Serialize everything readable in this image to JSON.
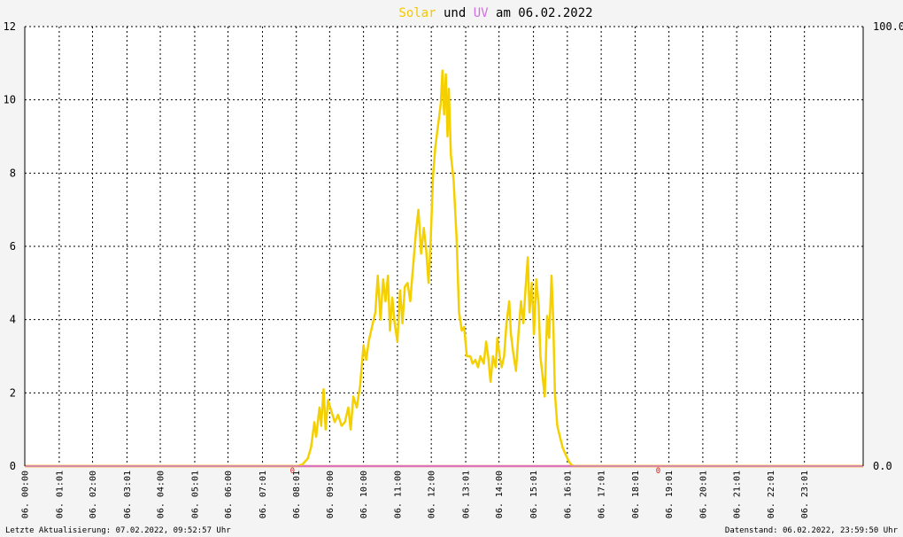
{
  "chart_data": {
    "type": "line",
    "title": {
      "solar_word": "Solar",
      "und_word": "und",
      "uv_word": "UV",
      "am_date": "am 06.02.2022"
    },
    "y_left": {
      "min": 0,
      "max": 12,
      "ticks": [
        "12",
        "10",
        "8",
        "6",
        "4",
        "2",
        "0"
      ]
    },
    "y_right": {
      "min": 0,
      "max": 100,
      "ticks": [
        "100.0",
        "0.0"
      ]
    },
    "x_range_hours": [
      0,
      24.75
    ],
    "x_ticks": [
      {
        "h": 0.0,
        "label": "06. 00:00"
      },
      {
        "h": 1.0167,
        "label": "06. 01:01"
      },
      {
        "h": 2.0,
        "label": "06. 02:00"
      },
      {
        "h": 3.0167,
        "label": "06. 03:01"
      },
      {
        "h": 4.0,
        "label": "06. 04:00"
      },
      {
        "h": 5.0167,
        "label": "06. 05:01"
      },
      {
        "h": 6.0,
        "label": "06. 06:00"
      },
      {
        "h": 7.0167,
        "label": "06. 07:01"
      },
      {
        "h": 8.0167,
        "label": "06. 08:01"
      },
      {
        "h": 9.0,
        "label": "06. 09:00"
      },
      {
        "h": 10.0,
        "label": "06. 10:00"
      },
      {
        "h": 11.0,
        "label": "06. 11:00"
      },
      {
        "h": 12.0,
        "label": "06. 12:00"
      },
      {
        "h": 13.0167,
        "label": "06. 13:01"
      },
      {
        "h": 14.0,
        "label": "06. 14:00"
      },
      {
        "h": 15.0167,
        "label": "06. 15:01"
      },
      {
        "h": 16.0167,
        "label": "06. 16:01"
      },
      {
        "h": 17.0167,
        "label": "06. 17:01"
      },
      {
        "h": 18.0167,
        "label": "06. 18:01"
      },
      {
        "h": 19.0167,
        "label": "06. 19:01"
      },
      {
        "h": 20.0167,
        "label": "06. 20:01"
      },
      {
        "h": 21.0167,
        "label": "06. 21:01"
      },
      {
        "h": 22.0167,
        "label": "06. 22:01"
      },
      {
        "h": 23.0167,
        "label": "06. 23:01"
      }
    ],
    "series": [
      {
        "name": "Solar",
        "color": "#f5d000",
        "points": [
          [
            0,
            0
          ],
          [
            8.05,
            0
          ],
          [
            8.2,
            0.05
          ],
          [
            8.35,
            0.2
          ],
          [
            8.45,
            0.5
          ],
          [
            8.55,
            1.2
          ],
          [
            8.6,
            0.8
          ],
          [
            8.7,
            1.6
          ],
          [
            8.75,
            1.1
          ],
          [
            8.82,
            2.1
          ],
          [
            8.88,
            1.0
          ],
          [
            8.95,
            1.8
          ],
          [
            9.05,
            1.5
          ],
          [
            9.15,
            1.2
          ],
          [
            9.25,
            1.4
          ],
          [
            9.35,
            1.1
          ],
          [
            9.45,
            1.2
          ],
          [
            9.55,
            1.6
          ],
          [
            9.62,
            1.0
          ],
          [
            9.7,
            1.9
          ],
          [
            9.8,
            1.6
          ],
          [
            9.9,
            2.2
          ],
          [
            10.0,
            3.3
          ],
          [
            10.08,
            2.9
          ],
          [
            10.15,
            3.4
          ],
          [
            10.25,
            3.8
          ],
          [
            10.35,
            4.2
          ],
          [
            10.42,
            5.2
          ],
          [
            10.5,
            4.0
          ],
          [
            10.58,
            5.1
          ],
          [
            10.65,
            4.5
          ],
          [
            10.72,
            5.2
          ],
          [
            10.78,
            3.7
          ],
          [
            10.85,
            4.6
          ],
          [
            10.92,
            3.9
          ],
          [
            11.0,
            3.4
          ],
          [
            11.08,
            4.8
          ],
          [
            11.15,
            3.9
          ],
          [
            11.22,
            4.9
          ],
          [
            11.3,
            5.0
          ],
          [
            11.38,
            4.5
          ],
          [
            11.45,
            5.3
          ],
          [
            11.55,
            6.4
          ],
          [
            11.62,
            7.0
          ],
          [
            11.7,
            5.8
          ],
          [
            11.78,
            6.5
          ],
          [
            11.85,
            5.9
          ],
          [
            11.92,
            5.0
          ],
          [
            11.98,
            6.1
          ],
          [
            12.05,
            7.9
          ],
          [
            12.12,
            8.7
          ],
          [
            12.2,
            9.3
          ],
          [
            12.28,
            9.9
          ],
          [
            12.33,
            10.8
          ],
          [
            12.38,
            9.6
          ],
          [
            12.43,
            10.7
          ],
          [
            12.48,
            9.0
          ],
          [
            12.52,
            10.3
          ],
          [
            12.58,
            8.5
          ],
          [
            12.66,
            7.8
          ],
          [
            12.75,
            6.2
          ],
          [
            12.82,
            4.2
          ],
          [
            12.9,
            3.7
          ],
          [
            12.97,
            3.8
          ],
          [
            13.05,
            3.0
          ],
          [
            13.15,
            3.0
          ],
          [
            13.22,
            2.8
          ],
          [
            13.3,
            2.9
          ],
          [
            13.38,
            2.7
          ],
          [
            13.45,
            3.0
          ],
          [
            13.55,
            2.8
          ],
          [
            13.62,
            3.4
          ],
          [
            13.68,
            3.0
          ],
          [
            13.75,
            2.3
          ],
          [
            13.82,
            3.0
          ],
          [
            13.9,
            2.7
          ],
          [
            13.95,
            3.5
          ],
          [
            14.02,
            3.0
          ],
          [
            14.08,
            2.7
          ],
          [
            14.15,
            3.0
          ],
          [
            14.22,
            3.9
          ],
          [
            14.3,
            4.5
          ],
          [
            14.35,
            3.6
          ],
          [
            14.42,
            3.1
          ],
          [
            14.5,
            2.6
          ],
          [
            14.58,
            3.7
          ],
          [
            14.65,
            4.5
          ],
          [
            14.72,
            3.9
          ],
          [
            14.78,
            4.8
          ],
          [
            14.85,
            5.7
          ],
          [
            14.9,
            4.2
          ],
          [
            14.97,
            5.0
          ],
          [
            15.03,
            3.6
          ],
          [
            15.1,
            5.1
          ],
          [
            15.17,
            4.4
          ],
          [
            15.22,
            3.0
          ],
          [
            15.28,
            2.5
          ],
          [
            15.35,
            1.9
          ],
          [
            15.42,
            4.1
          ],
          [
            15.48,
            3.5
          ],
          [
            15.55,
            5.2
          ],
          [
            15.6,
            4.0
          ],
          [
            15.65,
            2.0
          ],
          [
            15.72,
            1.1
          ],
          [
            15.8,
            0.8
          ],
          [
            15.88,
            0.5
          ],
          [
            15.95,
            0.35
          ],
          [
            16.05,
            0.15
          ],
          [
            16.12,
            0.05
          ],
          [
            16.2,
            0
          ],
          [
            24.75,
            0
          ]
        ]
      },
      {
        "name": "UV",
        "color": "#d070e0",
        "points": [
          [
            0,
            0
          ],
          [
            24.75,
            0
          ]
        ]
      }
    ],
    "zero_line_color": "#f08060",
    "min_marker": {
      "h": 7.9,
      "label": "0"
    },
    "max_marker": {
      "h": 18.7,
      "label": "0"
    },
    "grid": true
  },
  "footer": {
    "left": "Letzte Aktualisierung: 07.02.2022, 09:52:57 Uhr",
    "right": "Datenstand: 06.02.2022, 23:59:50 Uhr"
  }
}
